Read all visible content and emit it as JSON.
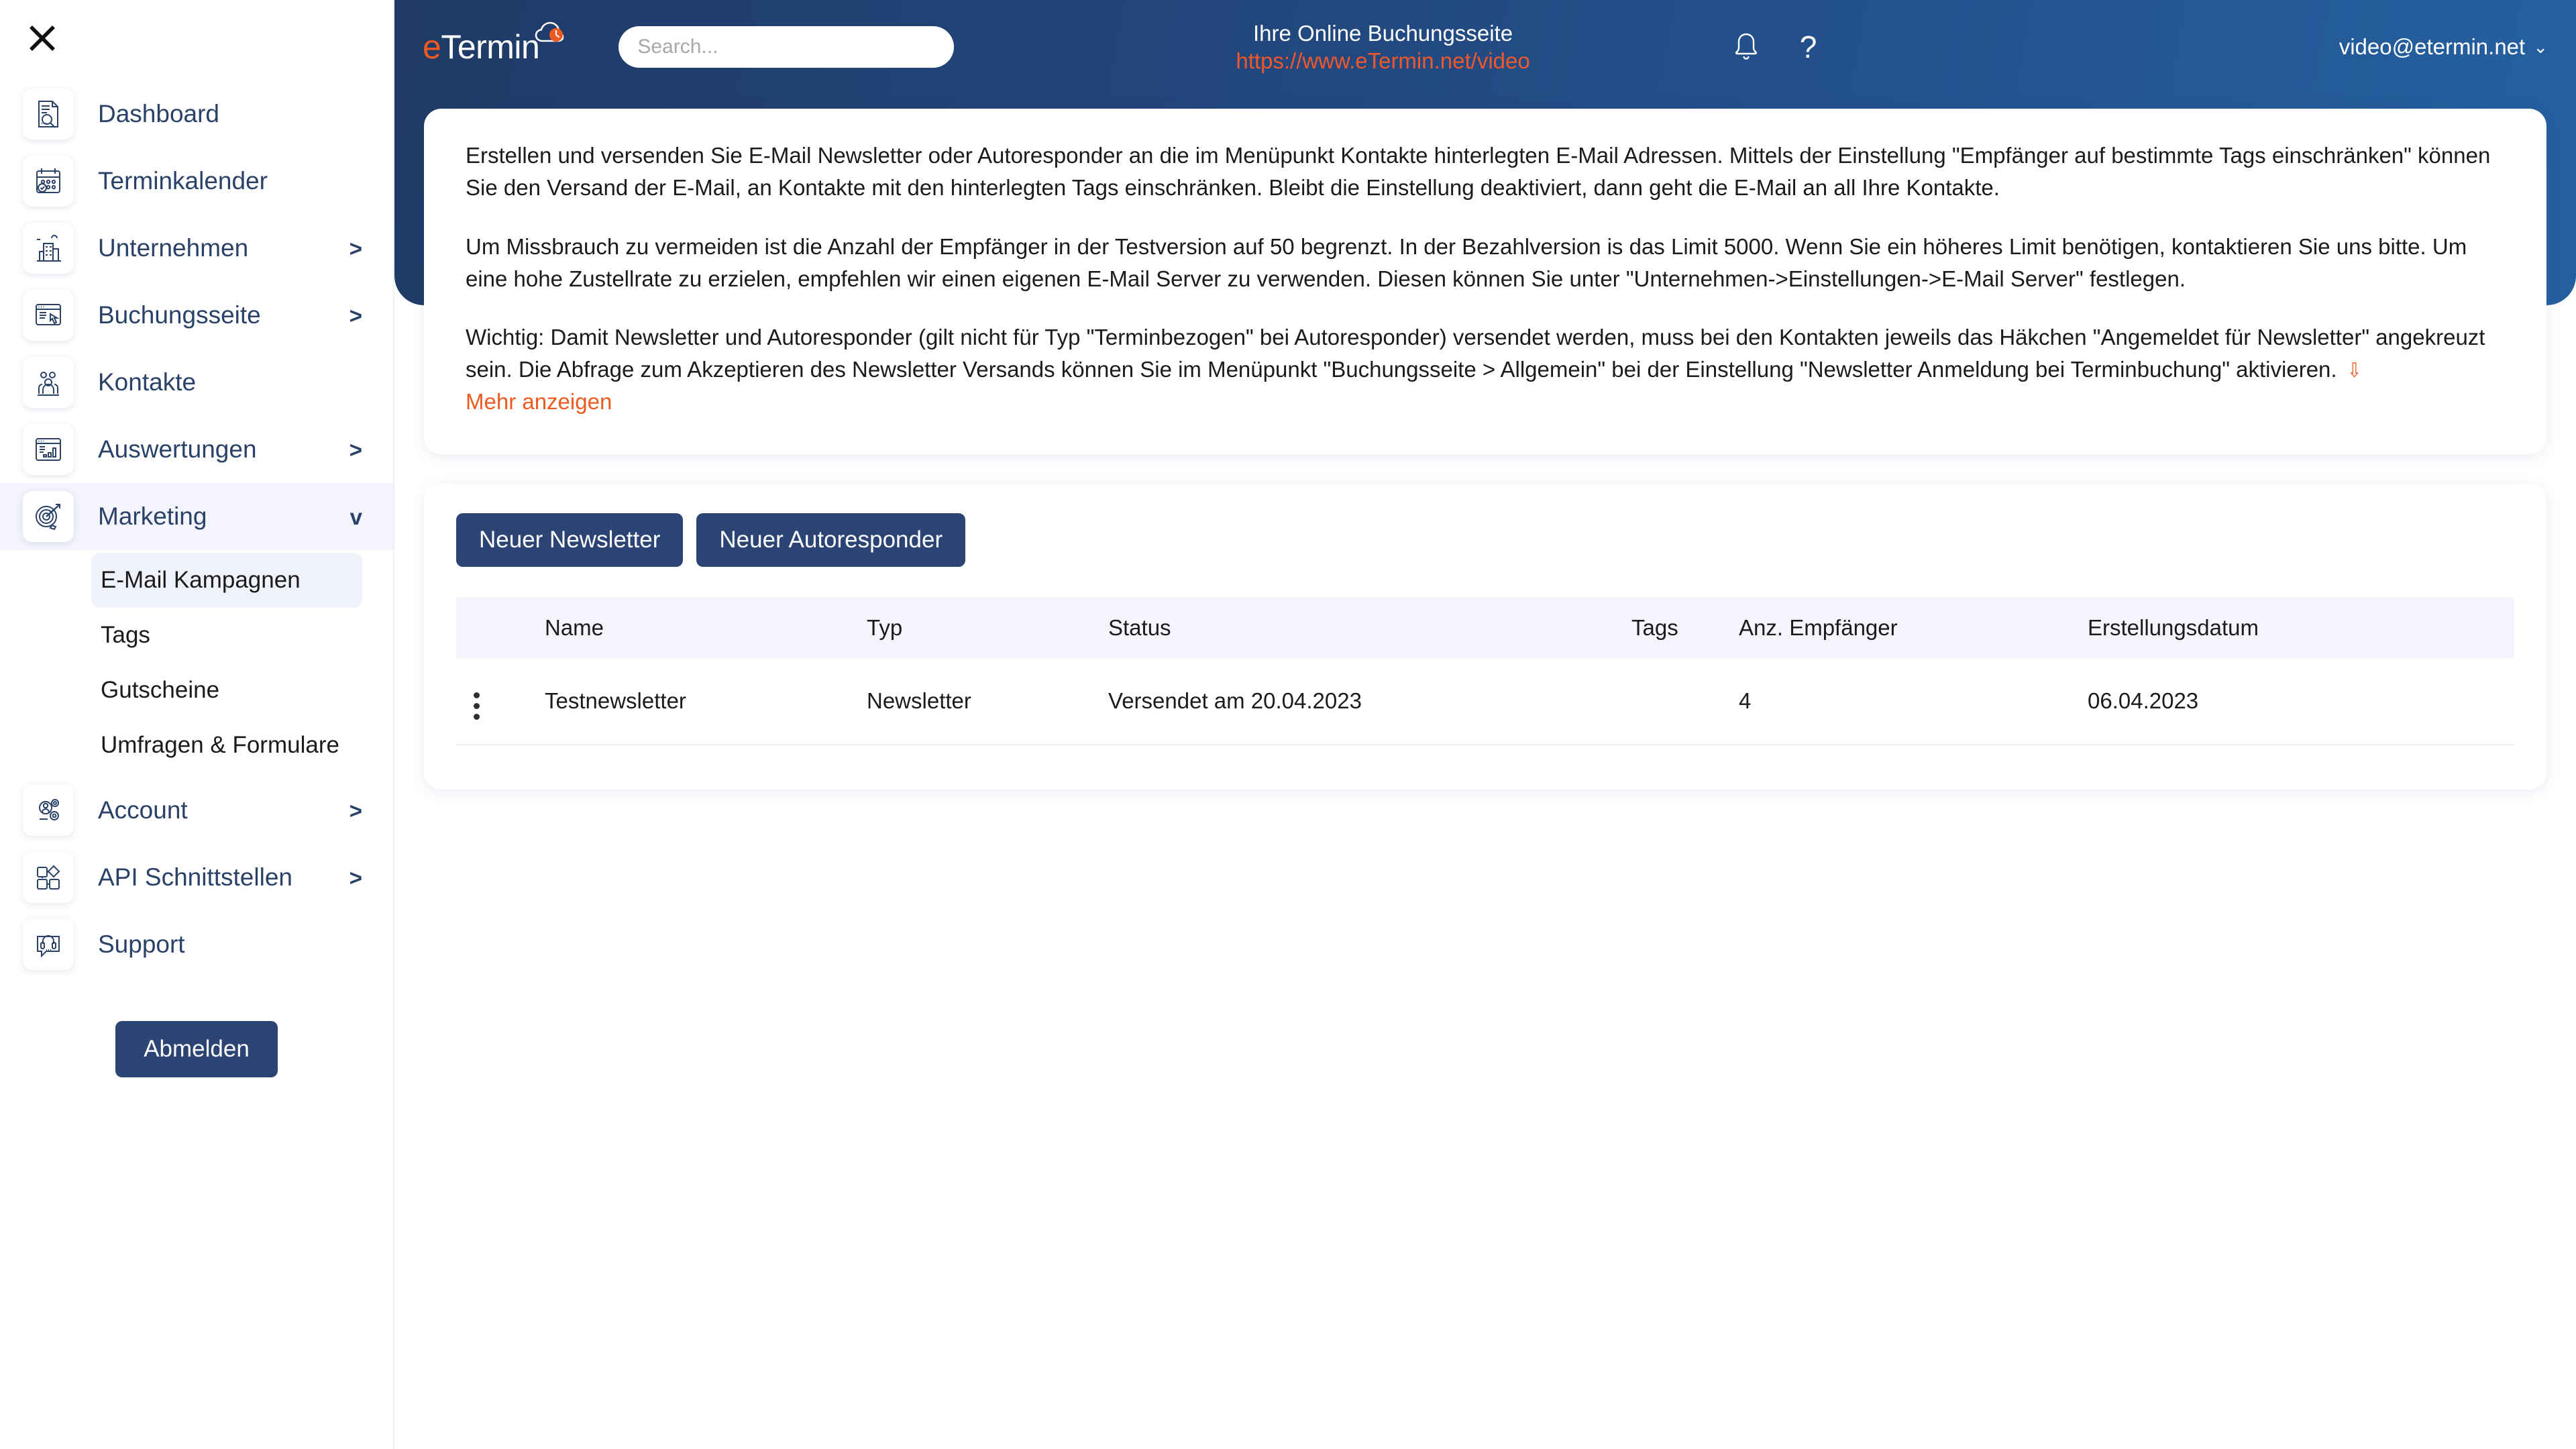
{
  "sidebar": {
    "close_icon": "close-icon",
    "items": [
      {
        "label": "Dashboard",
        "icon": "dashboard-icon",
        "chevron": "",
        "active": false
      },
      {
        "label": "Terminkalender",
        "icon": "calendar-icon",
        "chevron": "",
        "active": false
      },
      {
        "label": "Unternehmen",
        "icon": "building-icon",
        "chevron": ">",
        "active": false
      },
      {
        "label": "Buchungsseite",
        "icon": "bookingpage-icon",
        "chevron": ">",
        "active": false
      },
      {
        "label": "Kontakte",
        "icon": "contacts-icon",
        "chevron": "",
        "active": false
      },
      {
        "label": "Auswertungen",
        "icon": "analytics-icon",
        "chevron": ">",
        "active": false
      },
      {
        "label": "Marketing",
        "icon": "target-icon",
        "chevron": "v",
        "active": true
      },
      {
        "label": "Account",
        "icon": "account-icon",
        "chevron": ">",
        "active": false
      },
      {
        "label": "API Schnittstellen",
        "icon": "puzzle-icon",
        "chevron": ">",
        "active": false
      },
      {
        "label": "Support",
        "icon": "headset-icon",
        "chevron": "",
        "active": false
      }
    ],
    "submenu": [
      {
        "label": "E-Mail Kampagnen",
        "active": true
      },
      {
        "label": "Tags",
        "active": false
      },
      {
        "label": "Gutscheine",
        "active": false
      },
      {
        "label": "Umfragen & Formulare",
        "active": false
      }
    ],
    "logout_label": "Abmelden"
  },
  "header": {
    "logo_e": "e",
    "logo_rest": "Termin",
    "cloud_icon": "cloud-clock-icon",
    "search_placeholder": "Search...",
    "search_value": "",
    "booking_title": "Ihre Online Buchungsseite",
    "booking_url": "https://www.eTermin.net/video",
    "bell_icon": "bell-icon",
    "help_icon": "question-mark-icon",
    "user_email": "video@etermin.net",
    "user_caret": "⌄"
  },
  "info": {
    "p1": "Erstellen und versenden Sie E-Mail Newsletter oder Autoresponder an die im Menüpunkt Kontakte hinterlegten E-Mail Adressen. Mittels der Einstellung \"Empfänger auf bestimmte Tags einschränken\" können Sie den Versand der E-Mail, an Kontakte mit den hinterlegten Tags einschränken. Bleibt die Einstellung deaktiviert, dann geht die E-Mail an all Ihre Kontakte.",
    "p2": "Um Missbrauch zu vermeiden ist die Anzahl der Empfänger in der Testversion auf 50 begrenzt. In der Bezahlversion is das Limit 5000. Wenn Sie ein höheres Limit benötigen, kontaktieren Sie uns bitte. Um eine hohe Zustellrate zu erzielen, empfehlen wir einen eigenen E-Mail Server zu verwenden. Diesen können Sie unter \"Unternehmen->Einstellungen->E-Mail Server\" festlegen.",
    "p3": "Wichtig: Damit Newsletter und Autoresponder (gilt nicht für Typ \"Terminbezogen\" bei Autoresponder) versendet werden, muss bei den Kontakten jeweils das Häkchen \"Angemeldet für Newsletter\" angekreuzt sein. Die Abfrage zum Akzeptieren des Newsletter Versands können Sie im Menüpunkt \"Buchungsseite > Allgemein\" bei der Einstellung \"Newsletter Anmeldung bei Terminbuchung\" aktivieren. ",
    "more_label": "Mehr anzeigen",
    "more_chevron": "»"
  },
  "actions": {
    "new_newsletter": "Neuer Newsletter",
    "new_autoresponder": "Neuer Autoresponder"
  },
  "table": {
    "columns": [
      "",
      "Name",
      "Typ",
      "Status",
      "Tags",
      "Anz. Empfänger",
      "Erstellungsdatum"
    ],
    "rows": [
      {
        "menu_icon": "kebab-menu-icon",
        "name": "Testnewsletter",
        "typ": "Newsletter",
        "status": "Versendet am 20.04.2023",
        "tags": "",
        "recipients": "4",
        "created": "06.04.2023"
      }
    ]
  },
  "colors": {
    "header_blue": "#234c86",
    "accent_orange": "#ef5a21",
    "button_navy": "#2c4474",
    "active_bg": "#f3f4fc"
  }
}
